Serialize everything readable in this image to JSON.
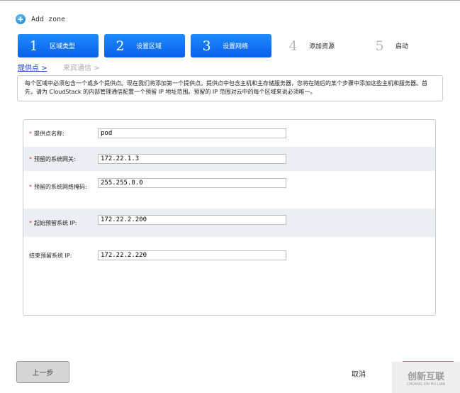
{
  "header": {
    "title": "Add zone"
  },
  "steps": [
    {
      "num": "1",
      "label": "区域类型"
    },
    {
      "num": "2",
      "label": "设置区域"
    },
    {
      "num": "3",
      "label": "设置网络"
    },
    {
      "num": "4",
      "label": "添加资源"
    },
    {
      "num": "5",
      "label": "启动"
    }
  ],
  "subtabs": [
    {
      "label": "提供点 >"
    },
    {
      "label": "来宾通信 >"
    }
  ],
  "description": "每个区域中必须包含一个或多个提供点。现在我们将添加第一个提供点。提供点中包含主机和主存储服务器，您将在随后的某个步骤中添加这些主机和服务器。首先，请为 CloudStack 的内部管理通信配置一个预留 IP 地址范围。预留的 IP 范围对云中的每个区域来说必须唯一。",
  "form": [
    {
      "label": "提供点名称:",
      "required": true,
      "value": "pod"
    },
    {
      "label": "预留的系统网关:",
      "required": true,
      "value": "172.22.1.3"
    },
    {
      "label": "预留的系统网络掩码:",
      "required": true,
      "value": "255.255.0.0"
    },
    {
      "label": "起始预留系统 IP:",
      "required": true,
      "value": "172.22.2.200"
    },
    {
      "label": "结束预留系统 IP:",
      "required": false,
      "value": "172.22.2.220"
    }
  ],
  "buttons": {
    "prev": "上一步",
    "cancel": "取消"
  },
  "watermark": {
    "name": "创新互联",
    "sub": "CHUANG XIN HU LIAN"
  },
  "req_mark": "*"
}
